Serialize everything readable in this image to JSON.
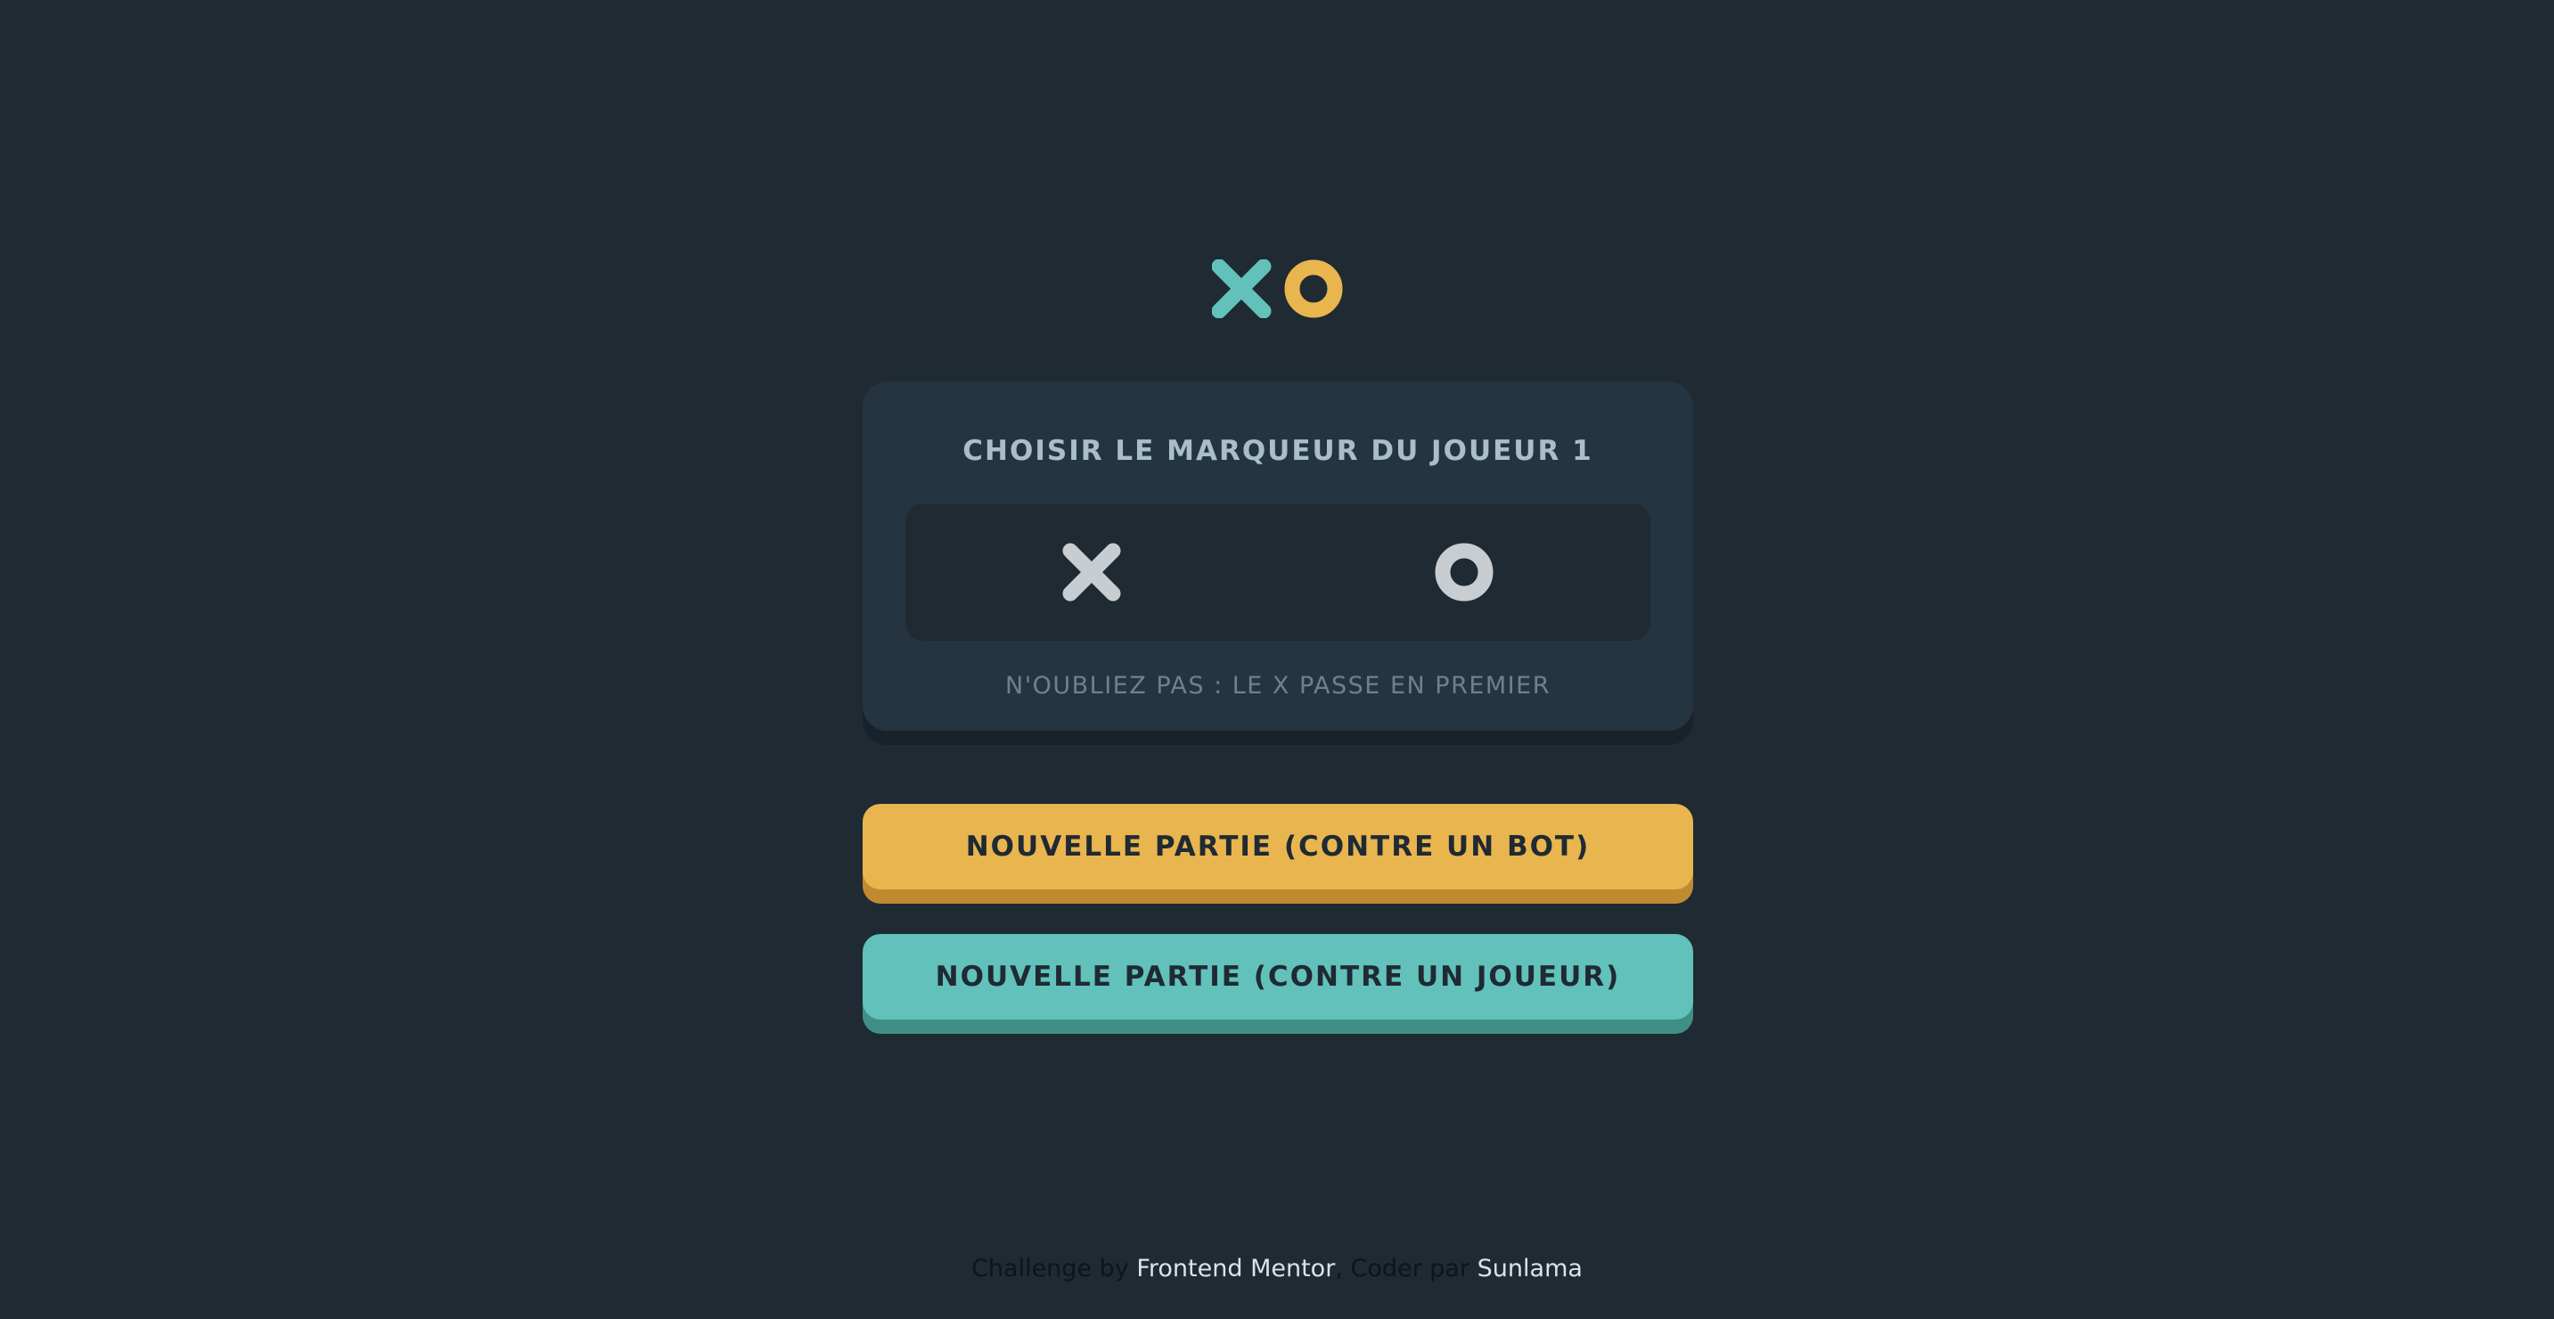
{
  "logo": {
    "x_color": "#62c1ba",
    "o_color": "#e9b54f",
    "x_icon": "x-mark-icon",
    "o_icon": "o-mark-icon"
  },
  "picker": {
    "title": "CHOISIR LE MARQUEUR DU JOUEUR 1",
    "options": [
      {
        "icon": "x-mark-icon",
        "color": "#c7cdd1"
      },
      {
        "icon": "o-mark-icon",
        "color": "#c7cdd1"
      }
    ],
    "reminder": "N'OUBLIEZ PAS : LE X PASSE EN PREMIER"
  },
  "buttons": {
    "vs_bot": "NOUVELLE PARTIE (CONTRE UN BOT)",
    "vs_player": "NOUVELLE PARTIE (CONTRE UN JOUEUR)"
  },
  "footer": {
    "prefix": "Challenge by ",
    "link1": "Frontend Mentor",
    "middle": ", Coder par ",
    "link2": "Sunlama"
  }
}
